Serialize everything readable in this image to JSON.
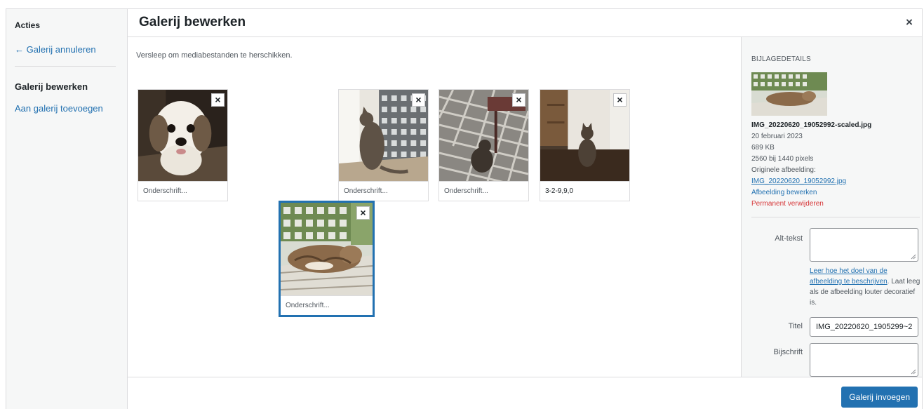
{
  "sidebar": {
    "heading": "Acties",
    "cancel_link": "← Galerij annuleren",
    "active_item": "Galerij bewerken",
    "add_link": "Aan galerij toevoegen"
  },
  "modal": {
    "title": "Galerij bewerken",
    "close_label": "×"
  },
  "content": {
    "instructions": "Versleep om mediabestanden te herschikken."
  },
  "gallery": {
    "remove_label": "×",
    "items": [
      {
        "caption": "Onderschrift...",
        "thumb": "dog"
      },
      {
        "caption": "Onderschrift...",
        "thumb": "cat-window"
      },
      {
        "caption": "Onderschrift...",
        "thumb": "cat-balcony"
      },
      {
        "caption": "3-2-9,9,0",
        "thumb": "cat-room"
      },
      {
        "caption": "Onderschrift...",
        "thumb": "cat-sleeping",
        "selected": true
      }
    ]
  },
  "details": {
    "heading": "Bijlagedetails",
    "filename": "IMG_20220620_19052992-scaled.jpg",
    "date": "20 februari 2023",
    "size": "689 KB",
    "dimensions": "2560 bij 1440 pixels",
    "original_label": "Originele afbeelding:",
    "original_link": "IMG_20220620_19052992.jpg",
    "edit_link": "Afbeelding bewerken",
    "delete_link": "Permanent verwijderen",
    "alt_label": "Alt-tekst",
    "alt_value": "",
    "help_link": "Leer hoe het doel van de afbeelding te beschrijven",
    "help_text": ". Laat leeg als de afbeelding louter decoratief is.",
    "title_label": "Titel",
    "title_value": "IMG_20220620_1905299~2",
    "caption_label": "Bijschrift",
    "caption_value": ""
  },
  "footer": {
    "insert_button": "Galerij invoegen"
  },
  "colors": {
    "accent": "#2271b1",
    "danger": "#d63638",
    "panel": "#f6f7f7"
  }
}
